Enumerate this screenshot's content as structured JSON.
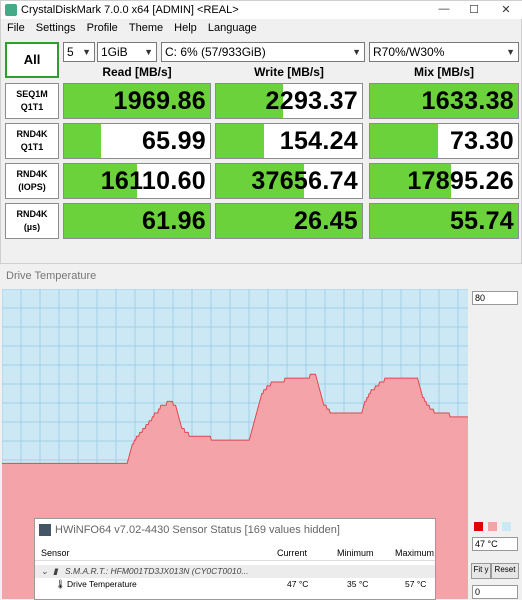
{
  "window": {
    "title": "CrystalDiskMark 7.0.0 x64 [ADMIN] <REAL>",
    "minimize": "—",
    "maximize": "☐",
    "close": "✕"
  },
  "menu": [
    "File",
    "Settings",
    "Profile",
    "Theme",
    "Help",
    "Language"
  ],
  "controls": {
    "all_label": "All",
    "count": "5",
    "size": "1GiB",
    "drive": "C: 6% (57/933GiB)",
    "mix": "R70%/W30%"
  },
  "columns": [
    "Read [MB/s]",
    "Write [MB/s]",
    "Mix [MB/s]"
  ],
  "tests": [
    {
      "line1": "SEQ1M",
      "line2": "Q1T1",
      "read": "1969.86",
      "write": "2293.37",
      "mix": "1633.38",
      "read_fill": 1.0,
      "write_fill": 0.46,
      "mix_fill": 1.0
    },
    {
      "line1": "RND4K",
      "line2": "Q1T1",
      "read": "65.99",
      "write": "154.24",
      "mix": "73.30",
      "read_fill": 0.25,
      "write_fill": 0.33,
      "mix_fill": 0.46
    },
    {
      "line1": "RND4K",
      "line2": "(IOPS)",
      "read": "16110.60",
      "write": "37656.74",
      "mix": "17895.26",
      "read_fill": 0.5,
      "write_fill": 0.6,
      "mix_fill": 0.55
    },
    {
      "line1": "RND4K",
      "line2": "(µs)",
      "read": "61.96",
      "write": "26.45",
      "mix": "55.74",
      "read_fill": 1.0,
      "write_fill": 1.0,
      "mix_fill": 1.0
    }
  ],
  "graph": {
    "title": "Drive Temperature",
    "max": "80",
    "min": "0",
    "current_temp": "47 °C",
    "fit_label": "Fit y",
    "reset_label": "Reset",
    "fill_color": "#f4a4a8",
    "line_color": "#e0474c",
    "grid_color": "#9fcfe6",
    "temperatures": [
      35,
      35,
      35,
      35,
      35,
      35,
      35,
      35,
      35,
      35,
      35,
      35,
      35,
      35,
      35,
      35,
      35,
      35,
      35,
      35,
      35,
      35,
      35,
      35,
      35,
      35,
      35,
      35,
      35,
      35,
      35,
      35,
      35,
      35,
      35,
      35,
      35,
      35,
      35,
      35,
      35,
      35,
      35,
      35,
      35,
      35,
      35,
      35,
      35,
      35,
      35,
      35,
      35,
      35,
      35,
      35,
      35,
      35,
      35,
      35,
      35,
      35,
      35,
      35,
      35,
      35,
      35,
      35,
      35,
      35,
      35,
      35,
      35,
      35,
      35,
      35,
      35,
      35,
      35,
      35,
      35,
      35,
      35,
      35,
      35,
      35,
      35,
      35,
      35,
      35,
      35,
      35,
      35,
      35,
      35,
      35,
      35,
      35,
      35,
      35,
      35,
      35,
      35,
      35,
      35,
      35,
      35,
      35,
      35,
      35,
      35,
      35,
      35,
      35,
      35,
      35,
      35,
      35,
      35,
      35,
      36,
      37,
      38,
      39,
      40,
      40,
      41,
      41,
      42,
      42,
      42,
      43,
      43,
      43,
      44,
      44,
      44,
      45,
      45,
      45,
      46,
      46,
      46,
      47,
      47,
      48,
      48,
      48,
      48,
      49,
      49,
      50,
      50,
      50,
      50,
      50,
      50,
      51,
      51,
      51,
      51,
      51,
      51,
      50,
      50,
      50,
      49,
      48,
      47,
      46,
      45,
      44,
      44,
      44,
      43,
      43,
      43,
      43,
      42,
      42,
      42,
      42,
      42,
      42,
      42,
      42,
      42,
      42,
      42,
      42,
      42,
      42,
      42,
      42,
      42,
      42,
      42,
      42,
      42,
      41,
      41,
      41,
      41,
      41,
      41,
      41,
      41,
      41,
      41,
      41,
      41,
      41,
      41,
      41,
      41,
      41,
      41,
      41,
      41,
      41,
      41,
      41,
      41,
      41,
      41,
      41,
      41,
      41,
      41,
      41,
      41,
      41,
      41,
      41,
      41,
      41,
      42,
      43,
      44,
      45,
      46,
      47,
      48,
      49,
      50,
      51,
      52,
      53,
      53,
      54,
      54,
      54,
      55,
      55,
      55,
      55,
      56,
      56,
      56,
      56,
      56,
      56,
      56,
      56,
      56,
      56,
      56,
      56,
      56,
      57,
      57,
      57,
      57,
      57,
      57,
      57,
      57,
      57,
      57,
      57,
      57,
      57,
      57,
      57,
      57,
      57,
      57,
      57,
      57,
      57,
      57,
      57,
      57,
      58,
      58,
      58,
      58,
      58,
      58,
      57,
      56,
      55,
      54,
      53,
      52,
      51,
      50,
      50,
      50,
      49,
      49,
      49,
      48,
      48,
      48,
      48,
      48,
      48,
      48,
      48,
      48,
      48,
      48,
      48,
      48,
      48,
      48,
      48,
      48,
      48,
      48,
      48,
      48,
      48,
      48,
      48,
      48,
      48,
      48,
      48,
      48,
      48,
      48,
      49,
      50,
      51,
      51,
      52,
      52,
      53,
      53,
      54,
      54,
      54,
      54,
      55,
      55,
      55,
      55,
      56,
      56,
      56,
      56,
      56,
      57,
      57,
      57,
      57,
      57,
      57,
      57,
      57,
      57,
      57,
      57,
      57,
      57,
      57,
      57,
      57,
      57,
      57,
      57,
      57,
      57,
      57,
      57,
      57,
      57,
      57,
      57,
      57,
      57,
      57,
      57,
      57,
      56,
      55,
      54,
      53,
      52,
      52,
      51,
      51,
      50,
      50,
      50,
      49,
      49,
      49,
      49,
      48,
      48,
      48,
      48,
      48,
      48,
      48,
      48,
      48,
      48,
      48,
      48,
      48,
      48,
      48,
      47,
      47,
      47,
      47,
      47,
      47,
      47,
      47,
      47,
      47,
      47,
      47,
      47,
      47,
      47,
      47,
      47,
      47
    ]
  },
  "hwinfo": {
    "title": "HWiNFO64 v7.02-4430 Sensor Status [169 values hidden]",
    "headers": {
      "sensor": "Sensor",
      "current": "Current",
      "minimum": "Minimum",
      "maximum": "Maximum"
    },
    "group": "S.M.A.R.T.: HFM001TD3JX013N (CY0CT0010...",
    "row": {
      "name": "Drive Temperature",
      "current": "47 °C",
      "minimum": "35 °C",
      "maximum": "57 °C"
    }
  }
}
